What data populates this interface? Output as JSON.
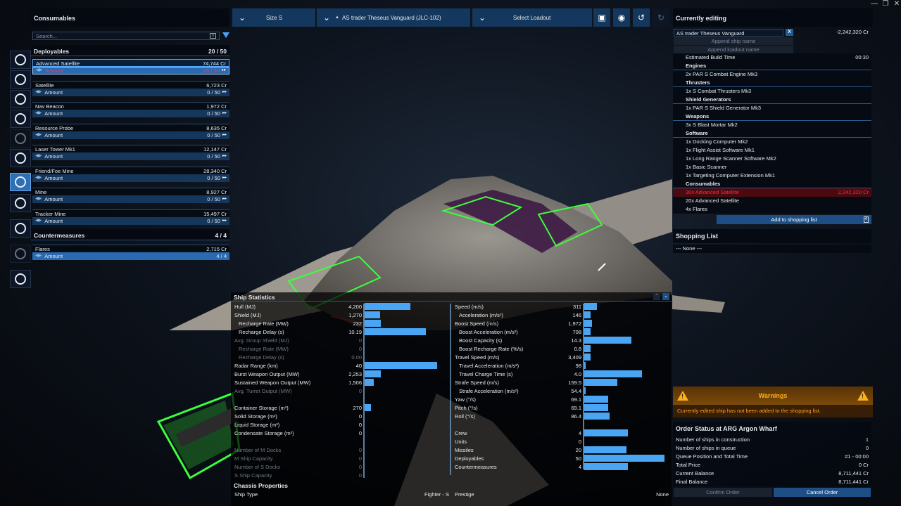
{
  "window": {
    "minimize": "—",
    "maximize": "❐",
    "close": "✕"
  },
  "rail": [
    {
      "icon": "ship-icon"
    },
    {
      "icon": "crosshair-icon"
    },
    {
      "icon": "shield-icon"
    },
    {
      "icon": "engine-icon"
    },
    {
      "icon": "thruster-icon"
    },
    {
      "icon": "software-icon"
    },
    {
      "icon": "deployable-icon"
    },
    {
      "icon": "crew-icon"
    },
    {
      "icon": "paint-icon"
    },
    {
      "icon": "disabled-icon"
    },
    {
      "icon": "settings-icon"
    }
  ],
  "consumables": {
    "title": "Consumables",
    "search_placeholder": "Search...",
    "search_clear": "0",
    "deployables": {
      "label": "Deployables",
      "count": "20 / 50"
    },
    "countermeasures": {
      "label": "Countermeasures",
      "count": "4 / 4"
    },
    "amount_label": "Amount",
    "items": [
      {
        "name": "Advanced Satellite",
        "price": "74,744 Cr",
        "amount": "20 / 50"
      },
      {
        "name": "Satellite",
        "price": "6,723 Cr",
        "amount": "0 / 50"
      },
      {
        "name": "Nav Beacon",
        "price": "1,972 Cr",
        "amount": "0 / 50"
      },
      {
        "name": "Resource Probe",
        "price": "8,635 Cr",
        "amount": "0 / 50"
      },
      {
        "name": "Laser Tower Mk1",
        "price": "12,147 Cr",
        "amount": "0 / 50"
      },
      {
        "name": "Friend/Foe Mine",
        "price": "28,340 Cr",
        "amount": "0 / 50"
      },
      {
        "name": "Mine",
        "price": "8,927 Cr",
        "amount": "0 / 50"
      },
      {
        "name": "Tracker Mine",
        "price": "15,497 Cr",
        "amount": "0 / 50"
      }
    ],
    "flares": {
      "name": "Flares",
      "price": "2,715 Cr",
      "amount": "4 / 4"
    }
  },
  "topbar": {
    "size": "Size S",
    "ship": "AS trader Theseus Vanguard (JLC-102)",
    "loadout": "Select Loadout"
  },
  "editing": {
    "title": "Currently editing",
    "ship_name": "AS trader Theseus Vanguard",
    "clear": "X",
    "price": "-2,242,320 Cr",
    "append_ship": "Append ship name",
    "append_loadout": "Append loadout name",
    "build_time_label": "Estimated Build Time",
    "build_time": "00:30",
    "sections": [
      {
        "title": "Engines",
        "items": [
          "2x PAR S Combat Engine Mk3"
        ]
      },
      {
        "title": "Thrusters",
        "items": [
          "1x S Combat Thrusters Mk3"
        ]
      },
      {
        "title": "Shield Generators",
        "items": [
          "1x PAR S Shield Generator Mk3"
        ]
      },
      {
        "title": "Weapons",
        "items": [
          "3x S Blast Mortar Mk2"
        ]
      },
      {
        "title": "Software",
        "items": [
          "1x Docking Computer Mk2",
          "1x Flight Assist Software Mk1",
          "1x Long Range Scanner Software Mk2",
          "1x Basic Scanner",
          "1x Targeting Computer Extension Mk1"
        ]
      },
      {
        "title": "Consumables",
        "items": []
      }
    ],
    "warn_item": "30x Advanced Satellite",
    "warn_price": "2,242,320 Cr",
    "cons_items": [
      "20x Advanced Satellite",
      "4x Flares"
    ],
    "add_button": "Add to shopping list",
    "add_count": "4"
  },
  "shopping": {
    "title": "Shopping List",
    "empty": "--- None ---"
  },
  "warnings": {
    "title": "Warnings",
    "text": "Currently edited ship has not been added to the shopping list."
  },
  "order": {
    "title": "Order Status at ARG Argon Wharf",
    "rows": [
      {
        "label": "Number of ships in construction",
        "value": "1"
      },
      {
        "label": "Number of ships in queue",
        "value": "0"
      },
      {
        "label": "Queue Position and Total Time",
        "value": "#1 - 00:00"
      },
      {
        "label": "Total Price",
        "value": "0 Cr"
      },
      {
        "label": "Current Balance",
        "value": "8,711,441 Cr"
      },
      {
        "label": "Final Balance",
        "value": "8,711,441 Cr"
      }
    ],
    "confirm": "Confirm Order",
    "cancel": "Cancel Order"
  },
  "stats": {
    "title": "Ship Statistics",
    "left": [
      {
        "name": "Hull (MJ)",
        "value": "4,200",
        "level": 0.75
      },
      {
        "name": "Shield (MJ)",
        "value": "1,270",
        "level": 0.25
      },
      {
        "name": "Recharge Rate (MW)",
        "value": "232",
        "level": 0.27,
        "indent": true
      },
      {
        "name": "Recharge Delay (s)",
        "value": "10.19",
        "level": 1.0,
        "indent": true
      },
      {
        "name": "Avg. Group Shield (MJ)",
        "value": "0",
        "level": 0,
        "dim": true
      },
      {
        "name": "Recharge Rate (MW)",
        "value": "0",
        "level": 0,
        "dim": true,
        "indent": true
      },
      {
        "name": "Recharge Delay (s)",
        "value": "0.00",
        "level": 0,
        "dim": true,
        "indent": true
      },
      {
        "name": "Radar Range (km)",
        "value": "40",
        "level": 1.18
      },
      {
        "name": "Burst Weapon Output (MW)",
        "value": "2,253",
        "level": 0.26
      },
      {
        "name": "Sustained Weapon Output (MW)",
        "value": "1,506",
        "level": 0.15
      },
      {
        "name": "Avg. Turret Output (MW)",
        "value": "0",
        "level": 0,
        "dim": true
      },
      {
        "name": "",
        "value": "",
        "level": 0
      },
      {
        "name": "Container Storage (m³)",
        "value": "270",
        "level": 0.1
      },
      {
        "name": "Solid Storage (m³)",
        "value": "0",
        "level": 0
      },
      {
        "name": "Liquid Storage (m³)",
        "value": "0",
        "level": 0
      },
      {
        "name": "Condensate Storage (m³)",
        "value": "0",
        "level": 0
      },
      {
        "name": "",
        "value": "",
        "level": 0
      },
      {
        "name": "Number of M Docks",
        "value": "0",
        "level": 0,
        "dim": true
      },
      {
        "name": "M Ship Capacity",
        "value": "0",
        "level": 0,
        "dim": true
      },
      {
        "name": "Number of S Docks",
        "value": "0",
        "level": 0,
        "dim": true
      },
      {
        "name": "S Ship Capacity",
        "value": "0",
        "level": 0,
        "dim": true
      }
    ],
    "right": [
      {
        "name": "Speed (m/s)",
        "value": "311",
        "level": 0.16
      },
      {
        "name": "Acceleration (m/s²)",
        "value": "146",
        "level": 0.08,
        "indent": true
      },
      {
        "name": "Boost Speed (m/s)",
        "value": "1,972",
        "level": 0.1
      },
      {
        "name": "Boost Acceleration (m/s²)",
        "value": "708",
        "level": 0.08,
        "indent": true
      },
      {
        "name": "Boost Capacity (s)",
        "value": "14.3",
        "level": 0.6,
        "indent": true
      },
      {
        "name": "Boost Recharge Rate (%/s)",
        "value": "0.8",
        "level": 0.08,
        "indent": true
      },
      {
        "name": "Travel Speed (m/s)",
        "value": "3,409",
        "level": 0.08
      },
      {
        "name": "Travel Acceleration (m/s²)",
        "value": "98",
        "level": 0.02,
        "indent": true
      },
      {
        "name": "Travel Charge Time (s)",
        "value": "4.0",
        "level": 0.73,
        "indent": true
      },
      {
        "name": "Strafe Speed (m/s)",
        "value": "159.5",
        "level": 0.42
      },
      {
        "name": "Strafe Acceleration (m/s²)",
        "value": "54.4",
        "level": 0.02,
        "indent": true
      },
      {
        "name": "Yaw (°/s)",
        "value": "69.1",
        "level": 0.3
      },
      {
        "name": "Pitch (°/s)",
        "value": "69.1",
        "level": 0.3
      },
      {
        "name": "Roll (°/s)",
        "value": "86.4",
        "level": 0.32
      },
      {
        "name": "",
        "value": "",
        "level": 0
      },
      {
        "name": "Crew",
        "value": "4",
        "level": 0.55
      },
      {
        "name": "Units",
        "value": "0",
        "level": 0
      },
      {
        "name": "Missiles",
        "value": "20",
        "level": 0.54
      },
      {
        "name": "Deployables",
        "value": "50",
        "level": 1.02
      },
      {
        "name": "Countermeasures",
        "value": "4",
        "level": 0.55
      }
    ],
    "chassis_title": "Chassis Properties",
    "ship_type_label": "Ship Type",
    "ship_type": "Fighter - S",
    "prestige_label": "Prestige",
    "prestige": "None"
  }
}
